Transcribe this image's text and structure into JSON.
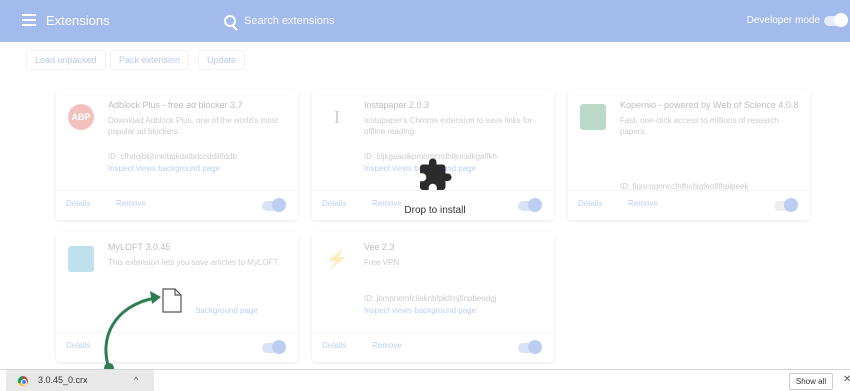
{
  "header": {
    "title": "Extensions",
    "search_placeholder": "Search extensions",
    "developer_mode_label": "Developer mode"
  },
  "actions": {
    "load_unpacked": "Load unpacked",
    "pack_extension": "Pack extension",
    "update": "Update"
  },
  "cards": [
    {
      "name": "Adblock Plus - free ad blocker 3.7",
      "description": "Download Adblock Plus, one of the world's most popular ad blockers.",
      "id": "ID: cfhdojbkjhnklbpkdaibdccddilifddb",
      "inspect": "Inspect views background page",
      "details": "Details",
      "remove": "Remove",
      "icon_text": "ABP",
      "icon_color": "#d9403a"
    },
    {
      "name": "Instapaper 2.0.3",
      "description": "Instapaper's Chrome extension to save links for offline reading.",
      "id": "ID: ldjkgaaoikpmhmcndhlljncidkgalfkh",
      "inspect": "Inspect views background page",
      "details": "Details",
      "remove": "Remove",
      "icon_text": "I",
      "icon_color": "#666666"
    },
    {
      "name": "Kopernio - powered by Web of Science 4.0.8",
      "description": "Fast, one-click access to millions of research papers.",
      "id": "ID: fjgncognnccfnfhchjgfeoflfhplpeek",
      "inspect": "",
      "details": "Details",
      "remove": "Remove",
      "icon_text": "",
      "icon_color": "#2e8b57"
    },
    {
      "name": "MyLOFT 3.0.45",
      "description": "This extension lets you save articles to MyLOFT.",
      "id": "",
      "inspect": "background page",
      "details": "Details",
      "remove": "",
      "icon_text": "",
      "icon_color": "#3aa0c9"
    },
    {
      "name": "Vee 2.3",
      "description": "Free VPN",
      "id": "ID: jbmpnemfcilaknbfpklfmjfinpbeodgj",
      "inspect": "Inspect views background page",
      "details": "Details",
      "remove": "Remove",
      "icon_text": "",
      "icon_color": "#f4b400"
    }
  ],
  "drop": {
    "label": "Drop to install"
  },
  "downloads": {
    "file_name": "3.0.45_0.crx",
    "show_all": "Show all",
    "close": "✕",
    "chevron": "^"
  },
  "colors": {
    "accent": "#3367d6",
    "arrow": "#2e7d52"
  }
}
